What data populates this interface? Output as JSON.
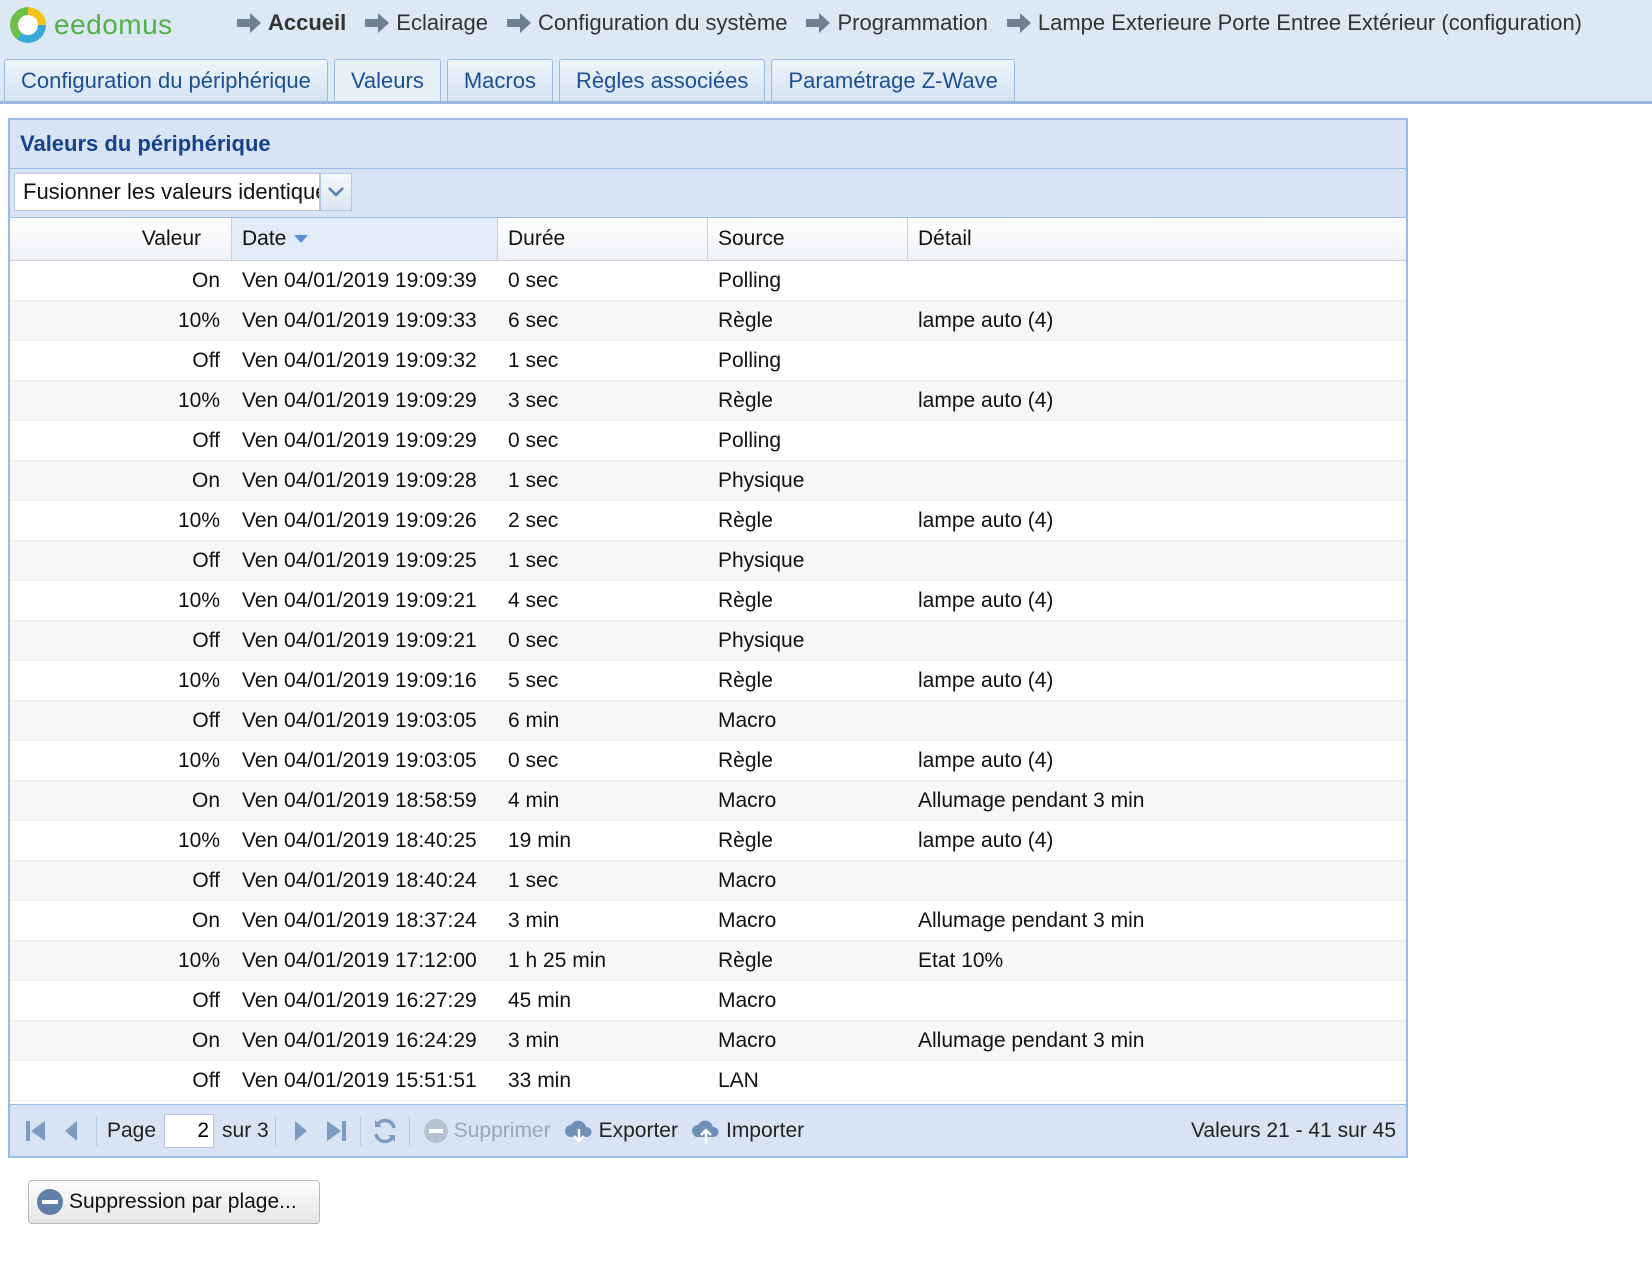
{
  "app": {
    "name": "eedomus"
  },
  "breadcrumbs": [
    "Accueil",
    "Eclairage",
    "Configuration du système",
    "Programmation",
    "Lampe Exterieure Porte Entree Extérieur (configuration)"
  ],
  "tabs": [
    "Configuration du périphérique",
    "Valeurs",
    "Macros",
    "Règles associées",
    "Paramétrage Z-Wave"
  ],
  "panel": {
    "title": "Valeurs du périphérique",
    "filter_value": "Fusionner les valeurs identiques"
  },
  "table": {
    "columns": [
      "Valeur",
      "Date",
      "Durée",
      "Source",
      "Détail"
    ],
    "rows": [
      [
        "On",
        "Ven 04/01/2019 19:09:39",
        "0 sec",
        "Polling",
        ""
      ],
      [
        "10%",
        "Ven 04/01/2019 19:09:33",
        "6 sec",
        "Règle",
        "lampe auto (4)"
      ],
      [
        "Off",
        "Ven 04/01/2019 19:09:32",
        "1 sec",
        "Polling",
        ""
      ],
      [
        "10%",
        "Ven 04/01/2019 19:09:29",
        "3 sec",
        "Règle",
        "lampe auto (4)"
      ],
      [
        "Off",
        "Ven 04/01/2019 19:09:29",
        "0 sec",
        "Polling",
        ""
      ],
      [
        "On",
        "Ven 04/01/2019 19:09:28",
        "1 sec",
        "Physique",
        ""
      ],
      [
        "10%",
        "Ven 04/01/2019 19:09:26",
        "2 sec",
        "Règle",
        "lampe auto (4)"
      ],
      [
        "Off",
        "Ven 04/01/2019 19:09:25",
        "1 sec",
        "Physique",
        ""
      ],
      [
        "10%",
        "Ven 04/01/2019 19:09:21",
        "4 sec",
        "Règle",
        "lampe auto (4)"
      ],
      [
        "Off",
        "Ven 04/01/2019 19:09:21",
        "0 sec",
        "Physique",
        ""
      ],
      [
        "10%",
        "Ven 04/01/2019 19:09:16",
        "5 sec",
        "Règle",
        "lampe auto (4)"
      ],
      [
        "Off",
        "Ven 04/01/2019 19:03:05",
        "6 min",
        "Macro",
        ""
      ],
      [
        "10%",
        "Ven 04/01/2019 19:03:05",
        "0 sec",
        "Règle",
        "lampe auto (4)"
      ],
      [
        "On",
        "Ven 04/01/2019 18:58:59",
        "4 min",
        "Macro",
        "Allumage pendant 3 min"
      ],
      [
        "10%",
        "Ven 04/01/2019 18:40:25",
        "19 min",
        "Règle",
        "lampe auto (4)"
      ],
      [
        "Off",
        "Ven 04/01/2019 18:40:24",
        "1 sec",
        "Macro",
        ""
      ],
      [
        "On",
        "Ven 04/01/2019 18:37:24",
        "3 min",
        "Macro",
        "Allumage pendant 3 min"
      ],
      [
        "10%",
        "Ven 04/01/2019 17:12:00",
        "1 h 25 min",
        "Règle",
        "Etat 10%"
      ],
      [
        "Off",
        "Ven 04/01/2019 16:27:29",
        "45 min",
        "Macro",
        ""
      ],
      [
        "On",
        "Ven 04/01/2019 16:24:29",
        "3 min",
        "Macro",
        "Allumage pendant 3 min"
      ],
      [
        "Off",
        "Ven 04/01/2019 15:51:51",
        "33 min",
        "LAN",
        ""
      ]
    ]
  },
  "pager": {
    "page_label": "Page",
    "page_value": "2",
    "of_label": "sur 3",
    "delete_label": "Supprimer",
    "export_label": "Exporter",
    "import_label": "Importer",
    "info": "Valeurs 21 - 41 sur 45"
  },
  "range_delete_label": "Suppression par plage...",
  "colors": {
    "accent": "#15428b",
    "header_bg": "#d8e4f3",
    "border": "#99bbe8",
    "logo_green": "#52b04a"
  }
}
